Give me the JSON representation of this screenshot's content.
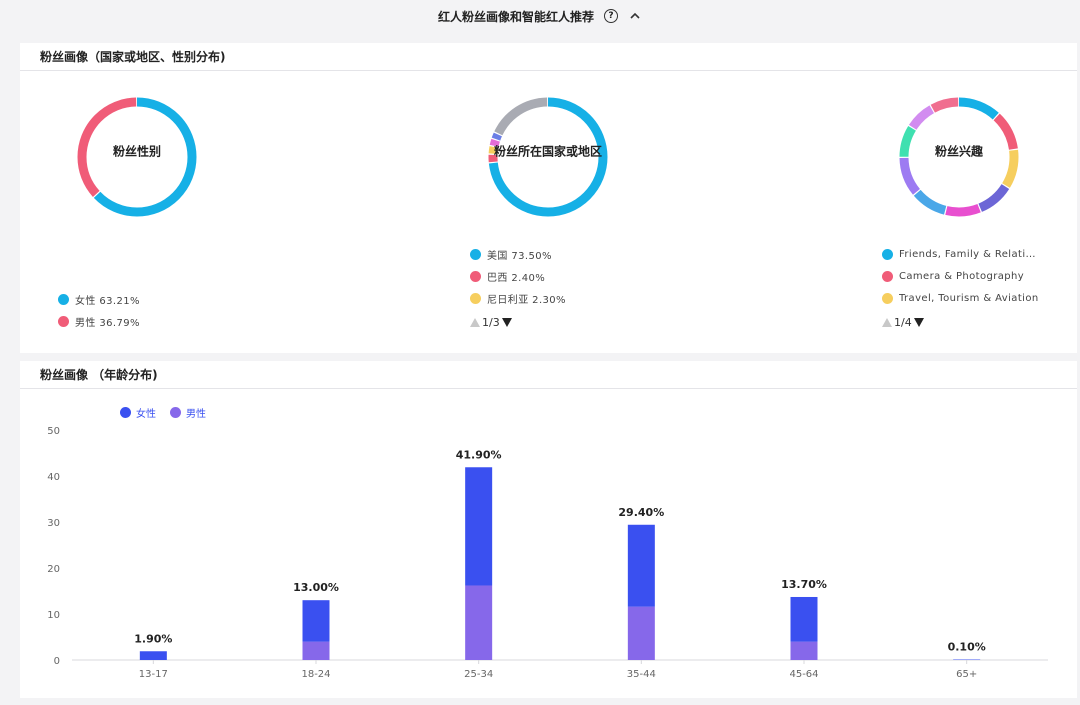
{
  "header": {
    "title": "红人粉丝画像和智能红人推荐",
    "help_icon": "question-circle-icon",
    "collapse_icon": "chevron-up-icon"
  },
  "demographics": {
    "title": "粉丝画像（国家或地区、性别分布)",
    "gender": {
      "center_label": "粉丝性别",
      "slices": [
        {
          "label": "女性 63.21%",
          "value": 63.21,
          "color": "#16b0e6"
        },
        {
          "label": "男性 36.79%",
          "value": 36.79,
          "color": "#f05c78"
        }
      ]
    },
    "country": {
      "center_label": "粉丝所在国家或地区",
      "slices": [
        {
          "value": 73.5,
          "color": "#16b0e6"
        },
        {
          "value": 2.4,
          "color": "#f05c78"
        },
        {
          "value": 2.3,
          "color": "#f6ce5e"
        },
        {
          "value": 2.0,
          "color": "#e56cd6"
        },
        {
          "value": 1.8,
          "color": "#6b7ee6"
        },
        {
          "value": 18.0,
          "color": "#a9abb3"
        }
      ],
      "legend": [
        {
          "label": "美国 73.50%",
          "color": "#16b0e6"
        },
        {
          "label": "巴西 2.40%",
          "color": "#f05c78"
        },
        {
          "label": "尼日利亚 2.30%",
          "color": "#f6ce5e"
        }
      ],
      "pager": "1/3"
    },
    "interests": {
      "center_label": "粉丝兴趣",
      "slices": [
        {
          "value": 12.0,
          "color": "#16b0e6"
        },
        {
          "value": 11.0,
          "color": "#f05c78"
        },
        {
          "value": 11.0,
          "color": "#f6ce5e"
        },
        {
          "value": 10.0,
          "color": "#6c66d6"
        },
        {
          "value": 10.0,
          "color": "#e84fcf"
        },
        {
          "value": 10.0,
          "color": "#4aa7e8"
        },
        {
          "value": 11.0,
          "color": "#9d7bf2"
        },
        {
          "value": 9.0,
          "color": "#3fe0b0"
        },
        {
          "value": 8.0,
          "color": "#d28cf0"
        },
        {
          "value": 8.0,
          "color": "#f06e8f"
        }
      ],
      "legend": [
        {
          "label": "Friends, Family & Relationships",
          "color": "#16b0e6"
        },
        {
          "label": "Camera & Photography",
          "color": "#f05c78"
        },
        {
          "label": "Travel, Tourism & Aviation",
          "color": "#f6ce5e"
        }
      ],
      "pager": "1/4"
    }
  },
  "age": {
    "title": "粉丝画像 （年龄分布)",
    "legend": [
      {
        "label": "女性",
        "color": "#3a50f0"
      },
      {
        "label": "男性",
        "color": "#8668ea"
      }
    ],
    "chart_data": {
      "type": "bar",
      "stacked": true,
      "categories": [
        "13-17",
        "18-24",
        "25-34",
        "35-44",
        "45-64",
        "65+"
      ],
      "series": [
        {
          "name": "男性",
          "values": [
            0,
            4,
            16.2,
            11.6,
            4.0,
            0
          ],
          "color": "#8668ea"
        },
        {
          "name": "女性",
          "values": [
            1.9,
            9.0,
            25.7,
            17.8,
            9.7,
            0.1
          ],
          "color": "#3a50f0"
        }
      ],
      "totals": [
        "1.90%",
        "13.00%",
        "41.90%",
        "29.40%",
        "13.70%",
        "0.10%"
      ],
      "yticks": [
        "0",
        "10",
        "20",
        "30",
        "40",
        "50"
      ],
      "ylim": [
        0,
        50
      ]
    }
  }
}
